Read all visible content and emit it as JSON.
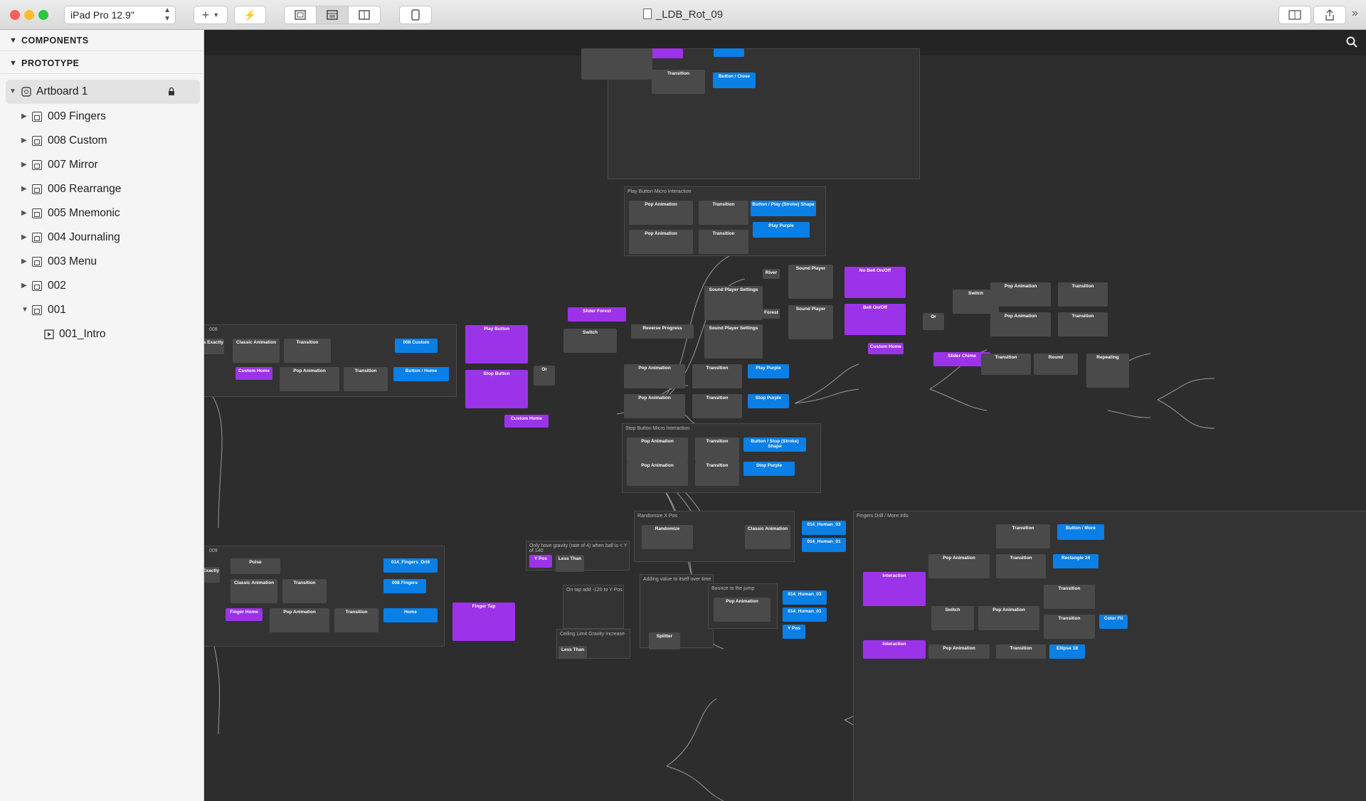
{
  "window": {
    "title": "_LDB_Rot_09",
    "device": "iPad Pro 12.9\"",
    "traffic_lights": {
      "close": "#fe5f57",
      "minimize": "#febc2e",
      "zoom": "#28c840"
    }
  },
  "toolbar": {
    "add_icon": "plus-icon",
    "lightning_icon": "lightning-icon",
    "view_buttons": [
      "layout-icon",
      "canvas-icon",
      "split-icon"
    ],
    "device_icon": "phone-icon",
    "right_buttons": [
      "mirror-icon",
      "share-icon"
    ],
    "overflow": "»"
  },
  "sidebar": {
    "sections": [
      {
        "label": "COMPONENTS"
      },
      {
        "label": "PROTOTYPE"
      }
    ],
    "artboard": {
      "label": "Artboard 1"
    },
    "layers": [
      {
        "label": "009 Fingers"
      },
      {
        "label": "008 Custom"
      },
      {
        "label": "007 Mirror"
      },
      {
        "label": "006 Rearrange"
      },
      {
        "label": "005 Mnemonic"
      },
      {
        "label": "004 Journaling"
      },
      {
        "label": "003 Menu"
      },
      {
        "label": "002"
      },
      {
        "label": "001"
      }
    ],
    "child": {
      "label": "001_Intro"
    }
  },
  "canvas": {
    "groups": {
      "play_micro": "Play Button Micro Interaction",
      "stop_micro": "Stop Button Micro Interaction",
      "g008": "008",
      "g009": "009",
      "randomize": "Randomize X Pos",
      "fingers_drill": "Fingers Drill / More Info",
      "gravity": "Only have gravity (rate of 4) when ball is < Y of 140",
      "tap_add": "On tap add -120 to Y Pos",
      "adding_value": "Adding value to itself over time",
      "bounce": "Bounce to the jump",
      "ceiling": "Ceiling Limit Gravity Increase"
    },
    "nodes": {
      "pop_animation": "Pop Animation",
      "transition": "Transition",
      "button_play_shape": "Button / Play (Stroke) Shape",
      "play_purple": "Play Purple",
      "play_button": "Play Button",
      "stop_button": "Stop Button",
      "interaction": "Interaction",
      "custom_home": "Custom Home",
      "slider_forest": "Slider Forest",
      "switch": "Switch",
      "or": "Or",
      "reverse_progress": "Reverse Progress",
      "sound_player_settings": "Sound Player Settings",
      "sound_player": "Sound Player",
      "river": "River",
      "forest": "Forest",
      "no_bell": "No Bell On/Off",
      "bell": "Bell On/Off",
      "slider_chime": "Slider Chime",
      "round": "Round",
      "repeating": "Repeating",
      "stop_purple": "Stop Purple",
      "button_stop_shape": "Button / Stop (Stroke) Shape",
      "equals_exactly": "Equals Exactly",
      "classic_animation": "Classic Animation",
      "custom_008": "008 Custom",
      "button_home": "Button / Home",
      "button_close": "Button / Close",
      "pulse": "Pulse",
      "fingers_drill_node": "014_Fingers_Drill",
      "fingers_008": "008 Fingers",
      "finger_home": "Finger Home",
      "home": "Home",
      "finger_tap": "Finger Tap",
      "y_pos": "Y Pos",
      "less_than": "Less Than",
      "randomize": "Randomize",
      "human_03": "014_Human_03",
      "human_01": "014_Human_01",
      "button_more": "Button / More",
      "rectangle_24": "Rectangle 24",
      "splitter": "Splitter",
      "ellipse_18": "Ellipse 18",
      "color_fill": "Color Fil"
    }
  }
}
